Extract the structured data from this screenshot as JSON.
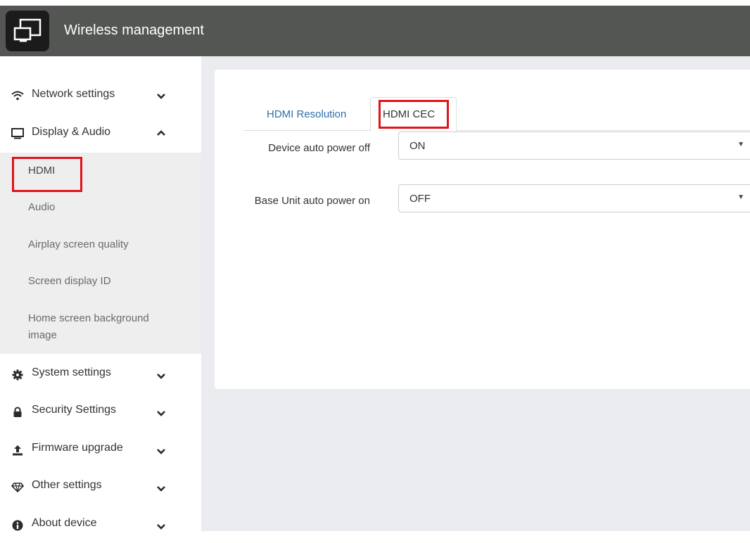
{
  "header": {
    "title": "Wireless management",
    "logo_icon": "screen-cast-icon"
  },
  "sidebar": {
    "items": [
      {
        "label": "Network settings",
        "icon": "wifi-icon",
        "expanded": false
      },
      {
        "label": "Display & Audio",
        "icon": "monitor-icon",
        "expanded": true
      },
      {
        "label": "System settings",
        "icon": "gear-icon",
        "expanded": false
      },
      {
        "label": "Security Settings",
        "icon": "lock-icon",
        "expanded": false
      },
      {
        "label": "Firmware upgrade",
        "icon": "upload-icon",
        "expanded": false
      },
      {
        "label": "Other settings",
        "icon": "diamond-icon",
        "expanded": false
      },
      {
        "label": "About device",
        "icon": "info-icon",
        "expanded": false
      }
    ],
    "display_submenu": [
      "HDMI",
      "Audio",
      "Airplay screen quality",
      "Screen display ID",
      "Home screen background image"
    ],
    "selected_submenu": "HDMI"
  },
  "main": {
    "tabs": [
      {
        "label": "HDMI Resolution",
        "active": false
      },
      {
        "label": "HDMI CEC",
        "active": true
      }
    ],
    "fields": [
      {
        "label": "Device auto power off",
        "value": "ON"
      },
      {
        "label": "Base Unit auto power on",
        "value": "OFF"
      }
    ]
  },
  "colors": {
    "header_bg": "#545654",
    "highlight": "#e0131b",
    "link": "#2f6fa8",
    "main_bg": "#eaecf0"
  }
}
